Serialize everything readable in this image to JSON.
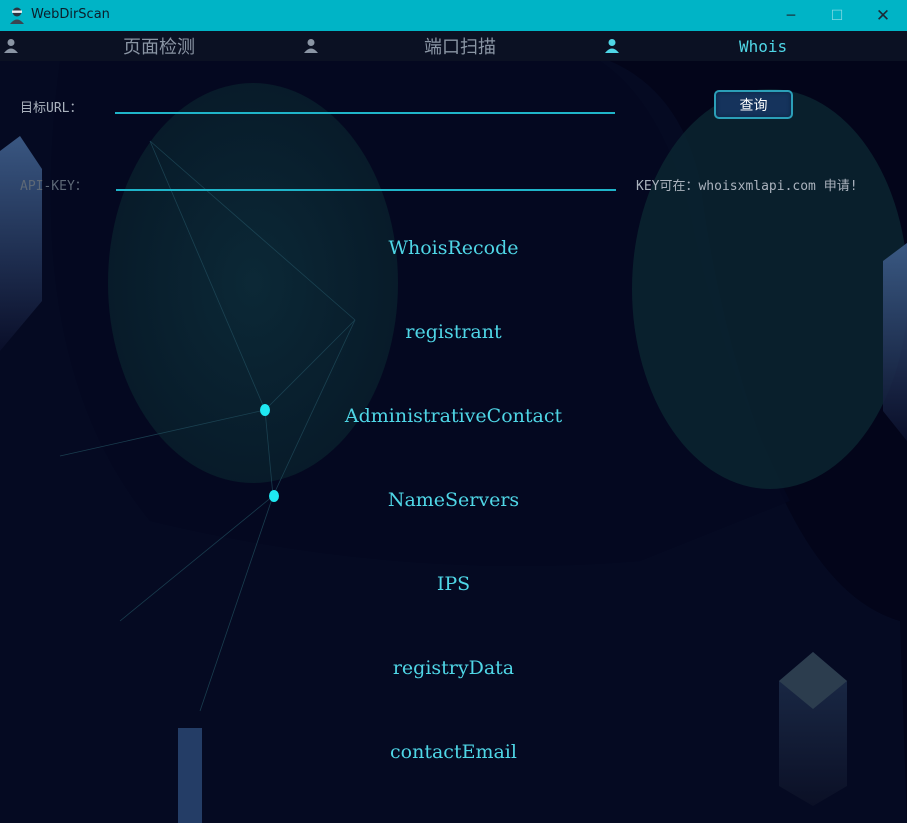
{
  "window": {
    "title": "WebDirScan",
    "minimize_label": "─",
    "maximize_label": "☐",
    "close_label": "✕"
  },
  "tabs": [
    {
      "label": "页面检测",
      "active": false
    },
    {
      "label": "端口扫描",
      "active": false
    },
    {
      "label": "Whois",
      "active": true
    }
  ],
  "form": {
    "url_label": "目标URL：",
    "url_value": "",
    "apikey_label": "API-KEY：",
    "apikey_value": "",
    "query_button": "查询",
    "key_hint": "KEY可在：whoisxmlapi.com 申请!"
  },
  "results": [
    "WhoisRecode",
    "registrant",
    "AdministrativeContact",
    "NameServers",
    "IPS",
    "registryData",
    "contactEmail"
  ],
  "colors": {
    "titlebar": "#00b4c6",
    "accent": "#4fd6e6",
    "background": "#03051a",
    "tab_inactive": "#8a95a4"
  }
}
